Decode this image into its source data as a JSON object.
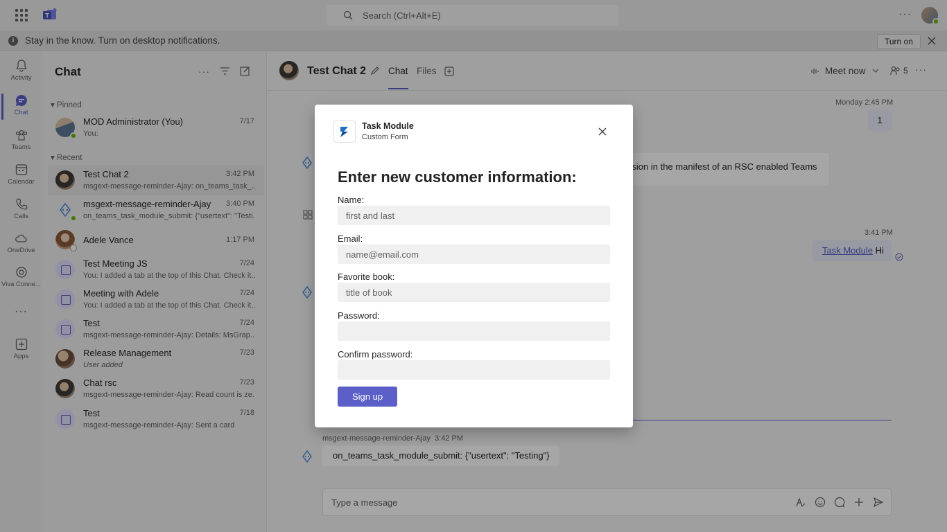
{
  "search": {
    "placeholder": "Search (Ctrl+Alt+E)"
  },
  "notification": {
    "text": "Stay in the know. Turn on desktop notifications.",
    "button": "Turn on"
  },
  "rail": [
    {
      "label": "Activity",
      "icon": "bell-icon"
    },
    {
      "label": "Chat",
      "icon": "chat-icon"
    },
    {
      "label": "Teams",
      "icon": "teams-icon"
    },
    {
      "label": "Calendar",
      "icon": "calendar-icon"
    },
    {
      "label": "Calls",
      "icon": "phone-icon"
    },
    {
      "label": "OneDrive",
      "icon": "cloud-icon"
    },
    {
      "label": "Viva Conne...",
      "icon": "viva-icon"
    },
    {
      "label": "...",
      "icon": "more-icon"
    },
    {
      "label": "Apps",
      "icon": "apps-icon"
    }
  ],
  "chatlist": {
    "title": "Chat",
    "pinned_label": "Pinned",
    "recent_label": "Recent",
    "pinned": [
      {
        "name": "MOD Administrator (You)",
        "preview": "You:",
        "time": "7/17"
      }
    ],
    "recent": [
      {
        "name": "Test Chat 2",
        "preview": "msgext-message-reminder-Ajay: on_teams_task_...",
        "time": "3:42 PM"
      },
      {
        "name": "msgext-message-reminder-Ajay",
        "preview": "on_teams_task_module_submit: {\"usertext\": \"Testi...",
        "time": "3:40 PM"
      },
      {
        "name": "Adele Vance",
        "preview": "",
        "time": "1:17 PM"
      },
      {
        "name": "Test Meeting JS",
        "preview": "You: I added a tab at the top of this Chat. Check it...",
        "time": "7/24"
      },
      {
        "name": "Meeting with Adele",
        "preview": "You: I added a tab at the top of this Chat. Check it...",
        "time": "7/24"
      },
      {
        "name": "Test",
        "preview": "msgext-message-reminder-Ajay: Details:  MsGrap...",
        "time": "7/24"
      },
      {
        "name": "Release Management",
        "preview": "User added",
        "time": "7/23"
      },
      {
        "name": "Chat rsc",
        "preview": "msgext-message-reminder-Ajay: Read count is ze...",
        "time": "7/23"
      },
      {
        "name": "Test",
        "preview": "msgext-message-reminder-Ajay: Sent a card",
        "time": "7/18"
      }
    ]
  },
  "main": {
    "title": "Test Chat 2",
    "tabs": [
      "Chat",
      "Files"
    ],
    "meet_now": "Meet now",
    "participants": "5",
    "msg1_time": "Monday 2:45 PM",
    "msg1_text": "1",
    "msg2_text": "ission in the manifest of an RSC enabled Teams",
    "msg3_time": "3:41 PM",
    "msg3_link": "Task Module",
    "msg3_text": "Hi",
    "msg4_sender": "msgext-message-reminder-Ajay",
    "msg4_time": "3:42 PM",
    "msg4_text": "on_teams_task_module_submit: {\"usertext\": \"Testing\"}",
    "composer_placeholder": "Type a message"
  },
  "dialog": {
    "app_name": "Task Module",
    "app_sub": "Custom Form",
    "form_title": "Enter new customer information:",
    "fields": [
      {
        "label": "Name:",
        "placeholder": "first and last"
      },
      {
        "label": "Email:",
        "placeholder": "name@email.com"
      },
      {
        "label": "Favorite book:",
        "placeholder": "title of book"
      },
      {
        "label": "Password:",
        "placeholder": ""
      },
      {
        "label": "Confirm password:",
        "placeholder": ""
      }
    ],
    "submit": "Sign up"
  },
  "colors": {
    "brand": "#5b5fc7",
    "presence_available": "#6bb700"
  }
}
